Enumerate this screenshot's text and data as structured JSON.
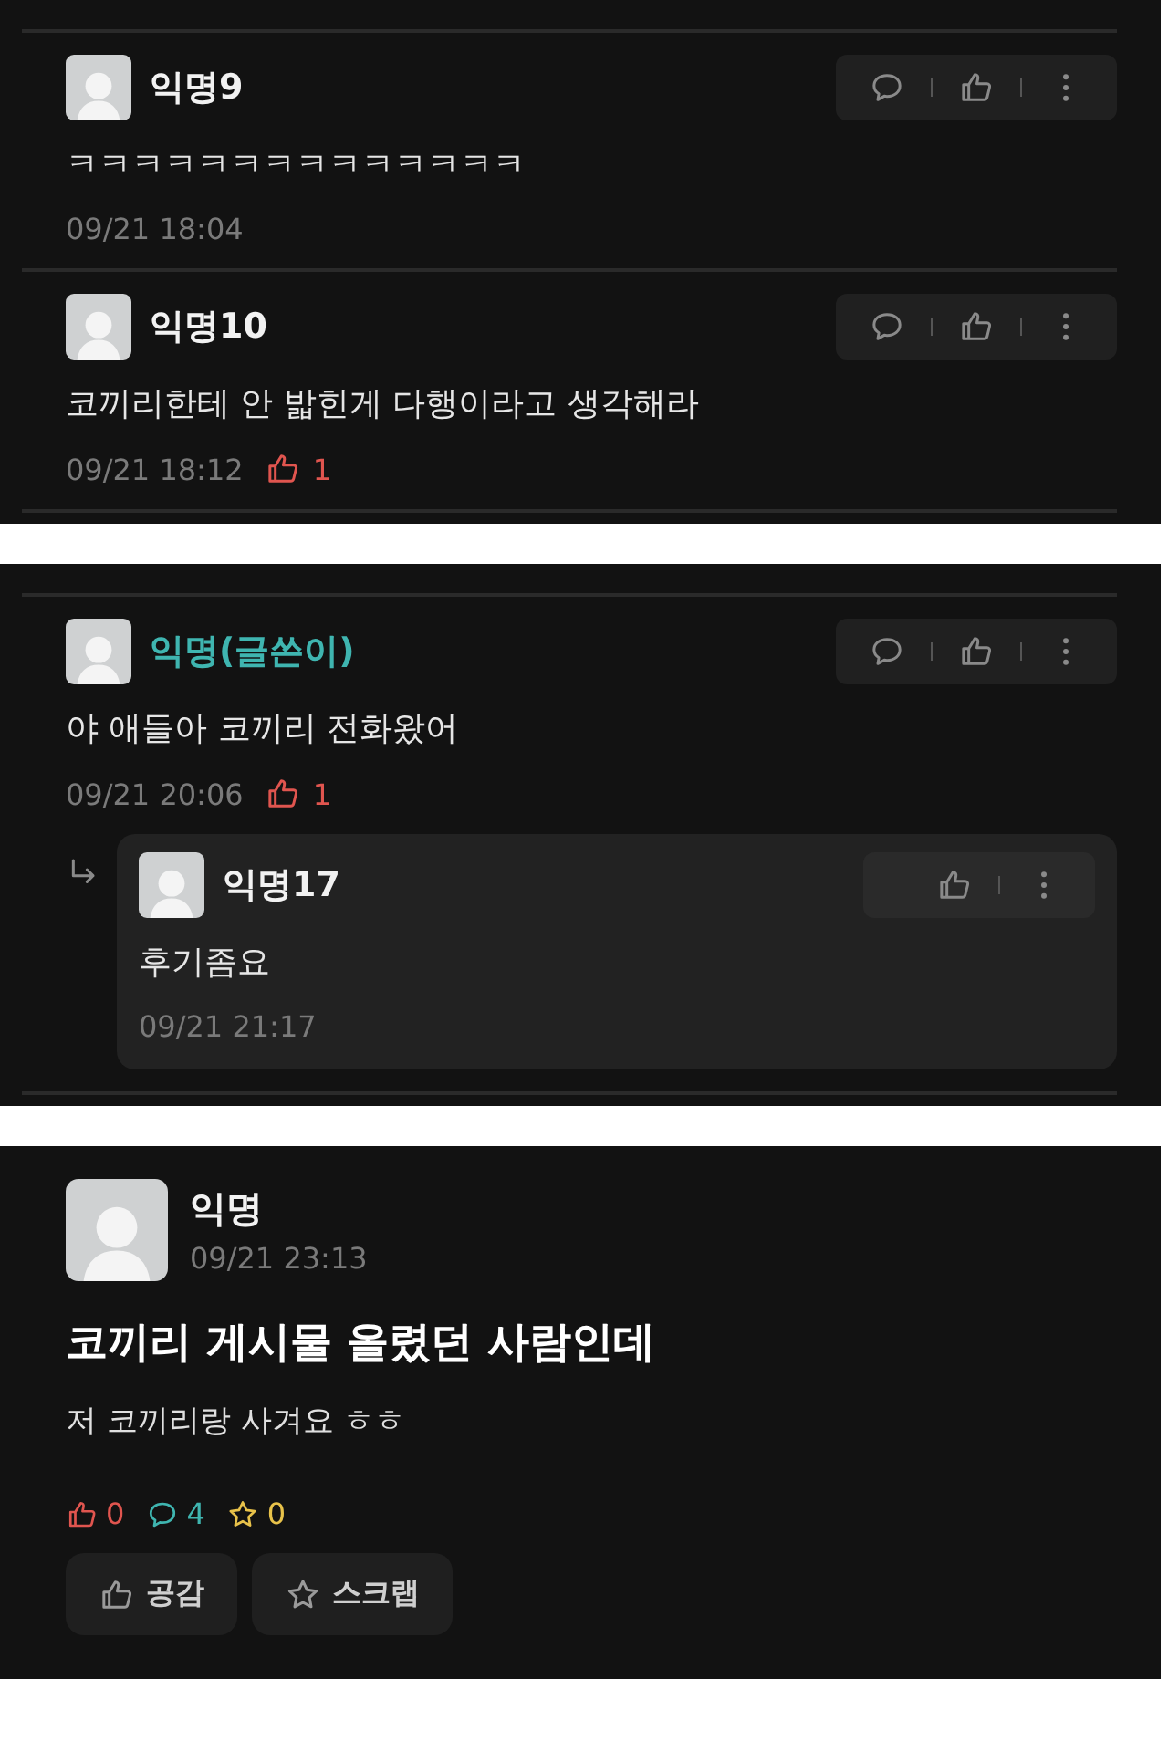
{
  "panels": [
    {
      "kind": "comments",
      "comments": [
        {
          "author": "익명9",
          "is_writer": false,
          "text": "ㅋㅋㅋㅋㅋㅋㅋㅋㅋㅋㅋㅋㅋㅋ",
          "time": "09/21 18:04"
        },
        {
          "author": "익명10",
          "is_writer": false,
          "text": "코끼리한테 안 밟힌게 다행이라고 생각해라",
          "time": "09/21 18:12",
          "likes": "1"
        }
      ]
    },
    {
      "kind": "comments",
      "comments": [
        {
          "author": "익명(글쓴이)",
          "is_writer": true,
          "text": "야 애들아 코끼리 전화왔어",
          "time": "09/21 20:06",
          "likes": "1",
          "children": [
            {
              "author": "익명17",
              "is_writer": false,
              "text": "후기좀요",
              "time": "09/21 21:17"
            }
          ]
        }
      ]
    },
    {
      "kind": "post",
      "author": "익명",
      "time": "09/21 23:13",
      "title": "코끼리 게시물 올렸던 사람인데",
      "body": "저 코끼리랑 사겨요 ㅎㅎ",
      "likes": "0",
      "comments": "4",
      "scraps": "0",
      "buttons": [
        {
          "kind": "like",
          "label": "공감"
        },
        {
          "kind": "scrap",
          "label": "스크랩"
        }
      ]
    }
  ]
}
